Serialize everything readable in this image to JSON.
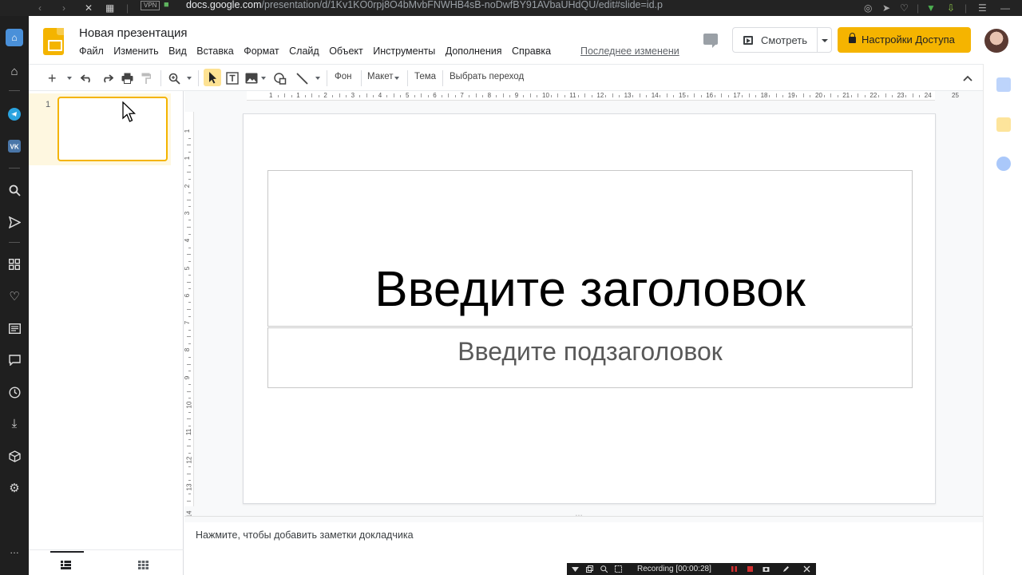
{
  "browser": {
    "url_domain": "docs.google.com",
    "url_path": "/presentation/d/1Kv1KO0rpj8O4bMvbFNWHB4sB-noDwfBY91AVbaUHdQU/edit#slide=id.p",
    "vpn_label": "VPN"
  },
  "app": {
    "title": "Новая презентация",
    "menu": [
      "Файл",
      "Изменить",
      "Вид",
      "Вставка",
      "Формат",
      "Слайд",
      "Объект",
      "Инструменты",
      "Дополнения",
      "Справка"
    ],
    "last_edit": "Последнее изменени",
    "present_label": "Смотреть",
    "share_label": "Настройки Доступа"
  },
  "toolbar": {
    "background_label": "Фон",
    "layout_label": "Макет",
    "theme_label": "Тема",
    "transition_label": "Выбрать переход"
  },
  "filmstrip": {
    "slide_number": "1"
  },
  "rulers": {
    "top_numbers": [
      "1",
      "1",
      "2",
      "3",
      "4",
      "5",
      "6",
      "7",
      "8",
      "9",
      "10",
      "11",
      "12",
      "13",
      "14",
      "15",
      "16",
      "17",
      "18",
      "19",
      "20",
      "21",
      "22",
      "23",
      "24",
      "25"
    ],
    "left_numbers": [
      "1",
      "1",
      "2",
      "3",
      "4",
      "5",
      "6",
      "7",
      "8",
      "9",
      "10",
      "11",
      "12",
      "13",
      "14"
    ]
  },
  "slide": {
    "title_placeholder": "Введите заголовок",
    "subtitle_placeholder": "Введите подзаголовок"
  },
  "notes": {
    "placeholder": "Нажмите, чтобы добавить заметки докладчика"
  },
  "recording": {
    "label": "Recording [00:00:28]"
  },
  "colors": {
    "accent_yellow": "#f4b400",
    "share_button": "#f5b400",
    "selected_slide_bg": "#fef7e0"
  }
}
